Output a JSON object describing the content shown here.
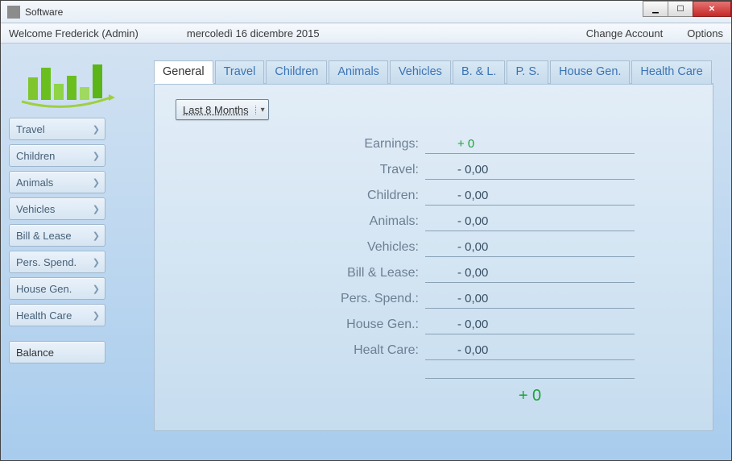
{
  "window": {
    "title": "Software"
  },
  "infobar": {
    "welcome": "Welcome Frederick   (Admin)",
    "date": "mercoledì 16 dicembre 2015",
    "change_account": "Change Account",
    "options": "Options"
  },
  "sidebar": {
    "items": [
      {
        "label": "Travel"
      },
      {
        "label": "Children"
      },
      {
        "label": "Animals"
      },
      {
        "label": "Vehicles"
      },
      {
        "label": "Bill & Lease"
      },
      {
        "label": "Pers. Spend."
      },
      {
        "label": "House Gen."
      },
      {
        "label": "Health Care"
      }
    ],
    "balance": "Balance"
  },
  "tabs": [
    {
      "label": "General"
    },
    {
      "label": "Travel"
    },
    {
      "label": "Children"
    },
    {
      "label": "Animals"
    },
    {
      "label": "Vehicles"
    },
    {
      "label": "B. & L."
    },
    {
      "label": "P. S."
    },
    {
      "label": "House Gen."
    },
    {
      "label": "Health Care"
    }
  ],
  "period": {
    "selected": "Last 8 Months"
  },
  "summary": {
    "rows": [
      {
        "label": "Earnings:",
        "value": "+ 0",
        "green": true
      },
      {
        "label": "Travel:",
        "value": "- 0,00"
      },
      {
        "label": "Children:",
        "value": "- 0,00"
      },
      {
        "label": "Animals:",
        "value": "- 0,00"
      },
      {
        "label": "Vehicles:",
        "value": "- 0,00"
      },
      {
        "label": "Bill & Lease:",
        "value": "- 0,00"
      },
      {
        "label": "Pers. Spend.:",
        "value": "- 0,00"
      },
      {
        "label": "House Gen.:",
        "value": "- 0,00"
      },
      {
        "label": "Healt Care:",
        "value": "- 0,00"
      }
    ],
    "total": "+ 0"
  }
}
